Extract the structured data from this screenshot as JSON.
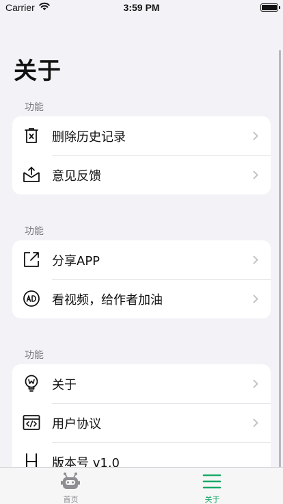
{
  "status_bar": {
    "carrier": "Carrier",
    "time": "3:59 PM"
  },
  "page": {
    "title": "关于"
  },
  "sections": [
    {
      "header": "功能",
      "items": [
        {
          "label": "删除历史记录",
          "icon": "trash-icon"
        },
        {
          "label": "意见反馈",
          "icon": "mail-tray-icon"
        }
      ]
    },
    {
      "header": "功能",
      "items": [
        {
          "label": "分享APP",
          "icon": "share-external-icon"
        },
        {
          "label": "看视频，给作者加油",
          "icon": "ad-icon"
        }
      ]
    },
    {
      "header": "功能",
      "items": [
        {
          "label": "关于",
          "icon": "lightbulb-icon"
        },
        {
          "label": "用户协议",
          "icon": "code-window-icon"
        },
        {
          "label": "版本号 v1.0",
          "icon": "letter-h-icon"
        }
      ]
    }
  ],
  "tab_bar": {
    "tabs": [
      {
        "label": "首页",
        "icon": "robot-icon",
        "active": false
      },
      {
        "label": "关于",
        "icon": "menu-icon",
        "active": true
      }
    ],
    "active_color": "#1aaa6a",
    "inactive_color": "#8e8e93"
  }
}
